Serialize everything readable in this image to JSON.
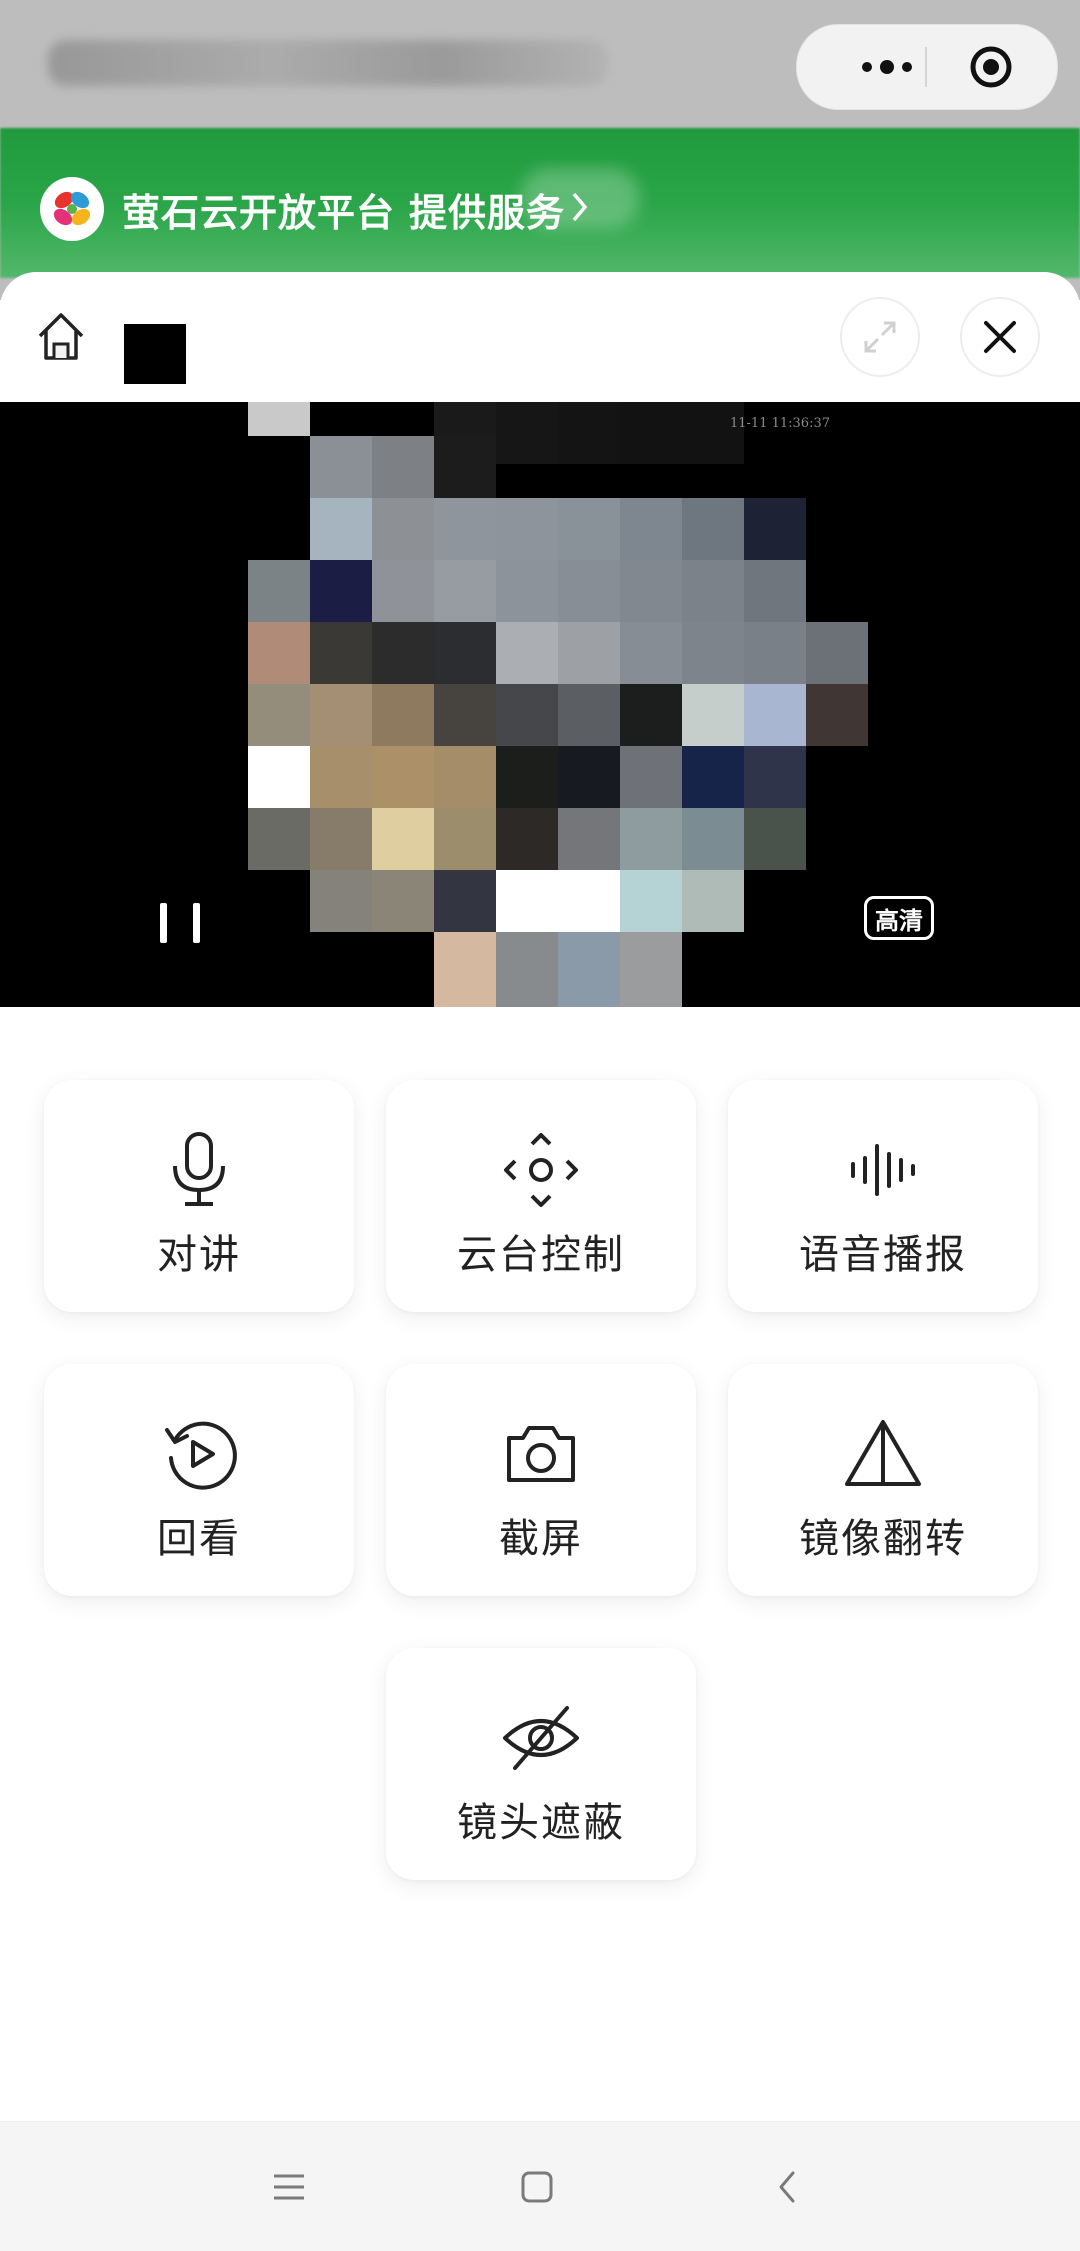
{
  "service": {
    "name": "萤石云开放平台",
    "suffix": "提供服务",
    "chevron": "chevron-right-icon"
  },
  "capsule": {
    "more_icon": "more-dots-icon",
    "close_icon": "target-circle-icon"
  },
  "header": {
    "home_icon": "home-icon",
    "expand_icon": "expand-icon",
    "close_icon": "close-icon"
  },
  "video": {
    "timestamp": "11-11 11:36:37",
    "quality_label": "高清",
    "pause_icon": "pause-icon"
  },
  "controls": [
    {
      "label": "对讲",
      "icon": "microphone-icon"
    },
    {
      "label": "云台控制",
      "icon": "ptz-control-icon"
    },
    {
      "label": "语音播报",
      "icon": "voice-wave-icon"
    },
    {
      "label": "回看",
      "icon": "playback-icon"
    },
    {
      "label": "截屏",
      "icon": "camera-icon"
    },
    {
      "label": "镜像翻转",
      "icon": "mirror-flip-icon"
    },
    {
      "label": "镜头遮蔽",
      "icon": "eye-off-icon"
    }
  ],
  "navbar": {
    "menu_icon": "menu-icon",
    "home_icon": "square-home-icon",
    "back_icon": "back-icon"
  },
  "colors": {
    "banner_green": "#2aa548",
    "text_dark": "#222222",
    "video_bg": "#000000",
    "sheet_bg": "#ffffff"
  }
}
